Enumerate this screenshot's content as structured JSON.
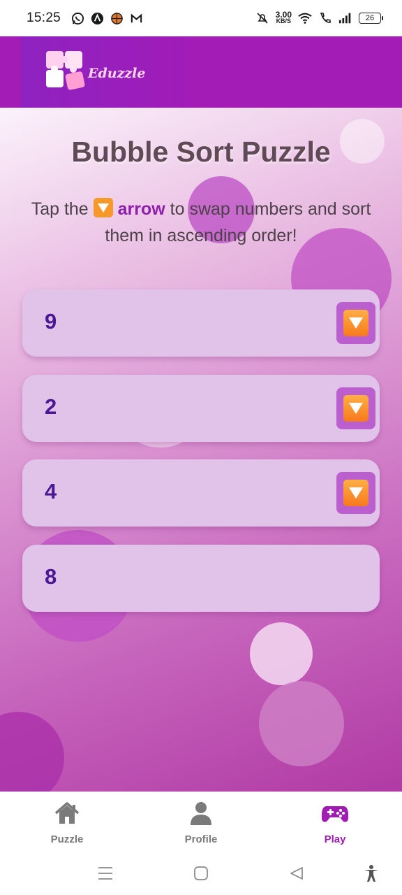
{
  "status_bar": {
    "time": "15:25",
    "net_speed_value": "3.00",
    "net_speed_unit": "KB/S",
    "battery": "26"
  },
  "header": {
    "logo_text": "Eduzzle"
  },
  "puzzle": {
    "title": "Bubble Sort Puzzle",
    "instruction_prefix": "Tap the",
    "instruction_highlight": "arrow",
    "instruction_suffix": "to swap numbers and sort them in ascending order!",
    "numbers": [
      "9",
      "2",
      "4",
      "8"
    ]
  },
  "bottom_nav": {
    "items": [
      {
        "label": "Puzzle",
        "icon": "home-icon"
      },
      {
        "label": "Profile",
        "icon": "person-icon"
      },
      {
        "label": "Play",
        "icon": "gamepad-icon"
      }
    ],
    "active": "Play"
  },
  "colors": {
    "brand": "#a21cb5",
    "number": "#4b1894",
    "card": "#e1c2e8",
    "swap_button": "#bb5fce",
    "arrow": "#f7791d"
  }
}
